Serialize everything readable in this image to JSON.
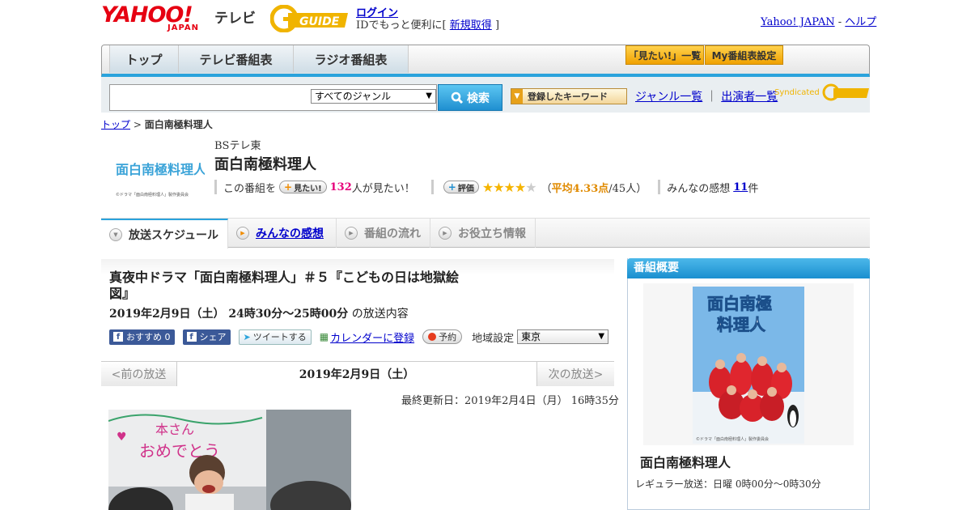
{
  "header": {
    "yahoo_logo": "YAHOO!",
    "yahoo_sub": "JAPAN",
    "tv_label": "テレビ",
    "gguide_logo": "GUIDE",
    "login": "ログイン",
    "login_sub_prefix": "IDでもっと便利に[",
    "signup": "新規取得",
    "login_sub_suffix": "]",
    "yahoo_japan_link": "Yahoo! JAPAN",
    "sep": " - ",
    "help_link": "ヘルプ"
  },
  "nav": {
    "tabs": [
      "トップ",
      "テレビ番組表",
      "ラジオ番組表"
    ],
    "mitai_list": "「見たい!」一覧",
    "my_settings": "My番組表設定"
  },
  "search": {
    "genre_selected": "すべてのジャンル",
    "button": "検索",
    "keyword_button": "登録したキーワード",
    "genre_list": "ジャンル一覧",
    "divider": "｜",
    "performer_list": "出演者一覧",
    "syndicated": "Syndicated"
  },
  "breadcrumb": {
    "top": "トップ",
    "sep": " > ",
    "current": "面白南極料理人"
  },
  "program": {
    "logo_text": "面白南極料理人",
    "logo_copyright": "©ドラマ「面白南極料理人」製作委員会",
    "channel": "BSテレ東",
    "title": "面白南極料理人",
    "mitai_prefix": "この番組を",
    "mitai_pill": "見たい!",
    "mitai_count": "132",
    "mitai_suffix": "人が見たい！",
    "rating_pill": "評価",
    "rating": 4.33,
    "rating_open": "（",
    "rating_avg": "平均4.33点",
    "rating_count": "/45人）",
    "impressions_prefix": "みんなの感想",
    "impressions_count": "11",
    "impressions_suffix": "件"
  },
  "tabs": {
    "schedule": "放送スケジュール",
    "impressions": "みんなの感想",
    "flow": "番組の流れ",
    "info": "お役立ち情報"
  },
  "episode": {
    "title": "真夜中ドラマ「面白南極料理人」＃５『こどもの日は地獄絵図』",
    "datetime": "2019年2月9日（土） 24時30分～25時00分",
    "datetime_suffix": "の放送内容",
    "fb_recommend": "おすすめ",
    "fb_count": "0",
    "fb_share": "シェア",
    "tweet": "ツイートする",
    "calendar": "カレンダーに登録",
    "reserve": "予約",
    "region_label": "地域設定",
    "region_selected": "東京"
  },
  "prevnext": {
    "prev": "<前の放送",
    "date": "2019年2月9日（土）",
    "next": "次の放送>"
  },
  "updated": "最終更新日：2019年2月4日（月） 16時35分",
  "photo_text": {
    "line1": "本さん",
    "line2": "おめでとう"
  },
  "sidebar": {
    "heading": "番組概要",
    "poster_title_1": "面白南極",
    "poster_title_2": "料理人",
    "poster_copyright": "©ドラマ「面白南極料理人」製作委員会",
    "title": "面白南極料理人",
    "regular": "レギュラー放送：日曜 0時00分～0時30分"
  },
  "colors": {
    "yahoo_red": "#e60012",
    "nav_blue": "#2aa3dc",
    "pink": "#e6007a",
    "star": "#f5b400"
  }
}
